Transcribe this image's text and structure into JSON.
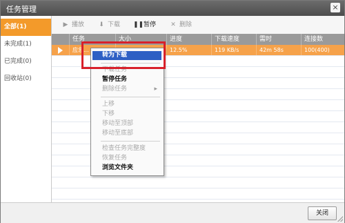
{
  "window": {
    "title": "任务管理",
    "close_glyph": "×"
  },
  "sidebar": {
    "items": [
      {
        "label": "全部(1)",
        "active": true
      },
      {
        "label": "未完成(1)",
        "active": false
      },
      {
        "label": "已完成(0)",
        "active": false
      },
      {
        "label": "回收站(0)",
        "active": false
      }
    ]
  },
  "toolbar": {
    "play": "播放",
    "download": "下载",
    "pause": "暂停",
    "delete": "删除"
  },
  "table": {
    "columns": [
      "",
      "任务",
      "大小",
      "进度",
      "下载速度",
      "需时",
      "连接数"
    ],
    "rows": [
      {
        "cells": [
          "",
          "应急...",
          "",
          "12.5%",
          "119 KB/s",
          "42m 58s",
          "100(400)"
        ]
      }
    ]
  },
  "context_menu": {
    "items": [
      {
        "label": "转为下载",
        "state": "highlighted"
      },
      {
        "label": "下载任务",
        "state": "disabled"
      },
      {
        "label": "暂停任务",
        "state": "enabled"
      },
      {
        "label": "删除任务",
        "state": "disabled",
        "submenu": true
      },
      {
        "label": "上移",
        "state": "disabled"
      },
      {
        "label": "下移",
        "state": "disabled"
      },
      {
        "label": "移动至顶部",
        "state": "disabled"
      },
      {
        "label": "移动至底部",
        "state": "disabled"
      },
      {
        "label": "检查任务完整度",
        "state": "disabled"
      },
      {
        "label": "恢复任务",
        "state": "disabled"
      },
      {
        "label": "浏览文件夹",
        "state": "enabled"
      }
    ]
  },
  "footer": {
    "close_label": "关闭"
  },
  "colors": {
    "accent": "#f39a2a",
    "highlight": "#2d5fc4",
    "callout": "#d8202a"
  }
}
